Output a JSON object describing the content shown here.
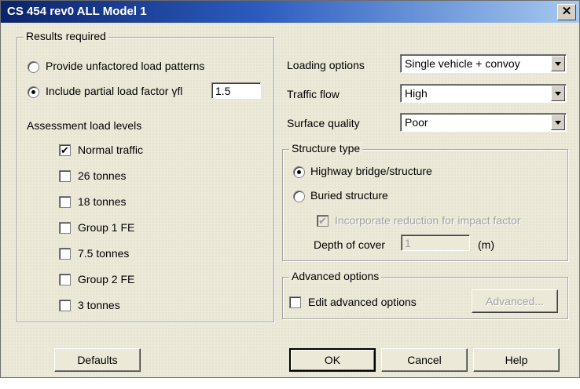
{
  "window": {
    "title": "CS 454 rev0 ALL Model 1",
    "close_glyph": "✕"
  },
  "results": {
    "legend": "Results required",
    "option_unfactored": "Provide unfactored load patterns",
    "option_partial": "Include partial load factor γfl",
    "partial_value": "1.5",
    "levels_heading": "Assessment load levels",
    "levels": [
      {
        "label": "Normal traffic",
        "checked": true
      },
      {
        "label": "26 tonnes",
        "checked": false
      },
      {
        "label": "18 tonnes",
        "checked": false
      },
      {
        "label": "Group 1 FE",
        "checked": false
      },
      {
        "label": "7.5 tonnes",
        "checked": false
      },
      {
        "label": "Group 2 FE",
        "checked": false
      },
      {
        "label": "3 tonnes",
        "checked": false
      }
    ]
  },
  "options": {
    "loading_label": "Loading options",
    "loading_value": "Single vehicle + convoy",
    "traffic_label": "Traffic flow",
    "traffic_value": "High",
    "surface_label": "Surface quality",
    "surface_value": "Poor"
  },
  "structure": {
    "legend": "Structure type",
    "option_highway": "Highway bridge/structure",
    "option_buried": "Buried structure",
    "impact_label": "Incorporate reduction for impact factor",
    "depth_label": "Depth of cover",
    "depth_value": "1",
    "depth_unit": "(m)"
  },
  "advanced": {
    "legend": "Advanced options",
    "edit_label": "Edit advanced options",
    "button_label": "Advanced..."
  },
  "buttons": {
    "defaults": "Defaults",
    "ok": "OK",
    "cancel": "Cancel",
    "help": "Help"
  }
}
